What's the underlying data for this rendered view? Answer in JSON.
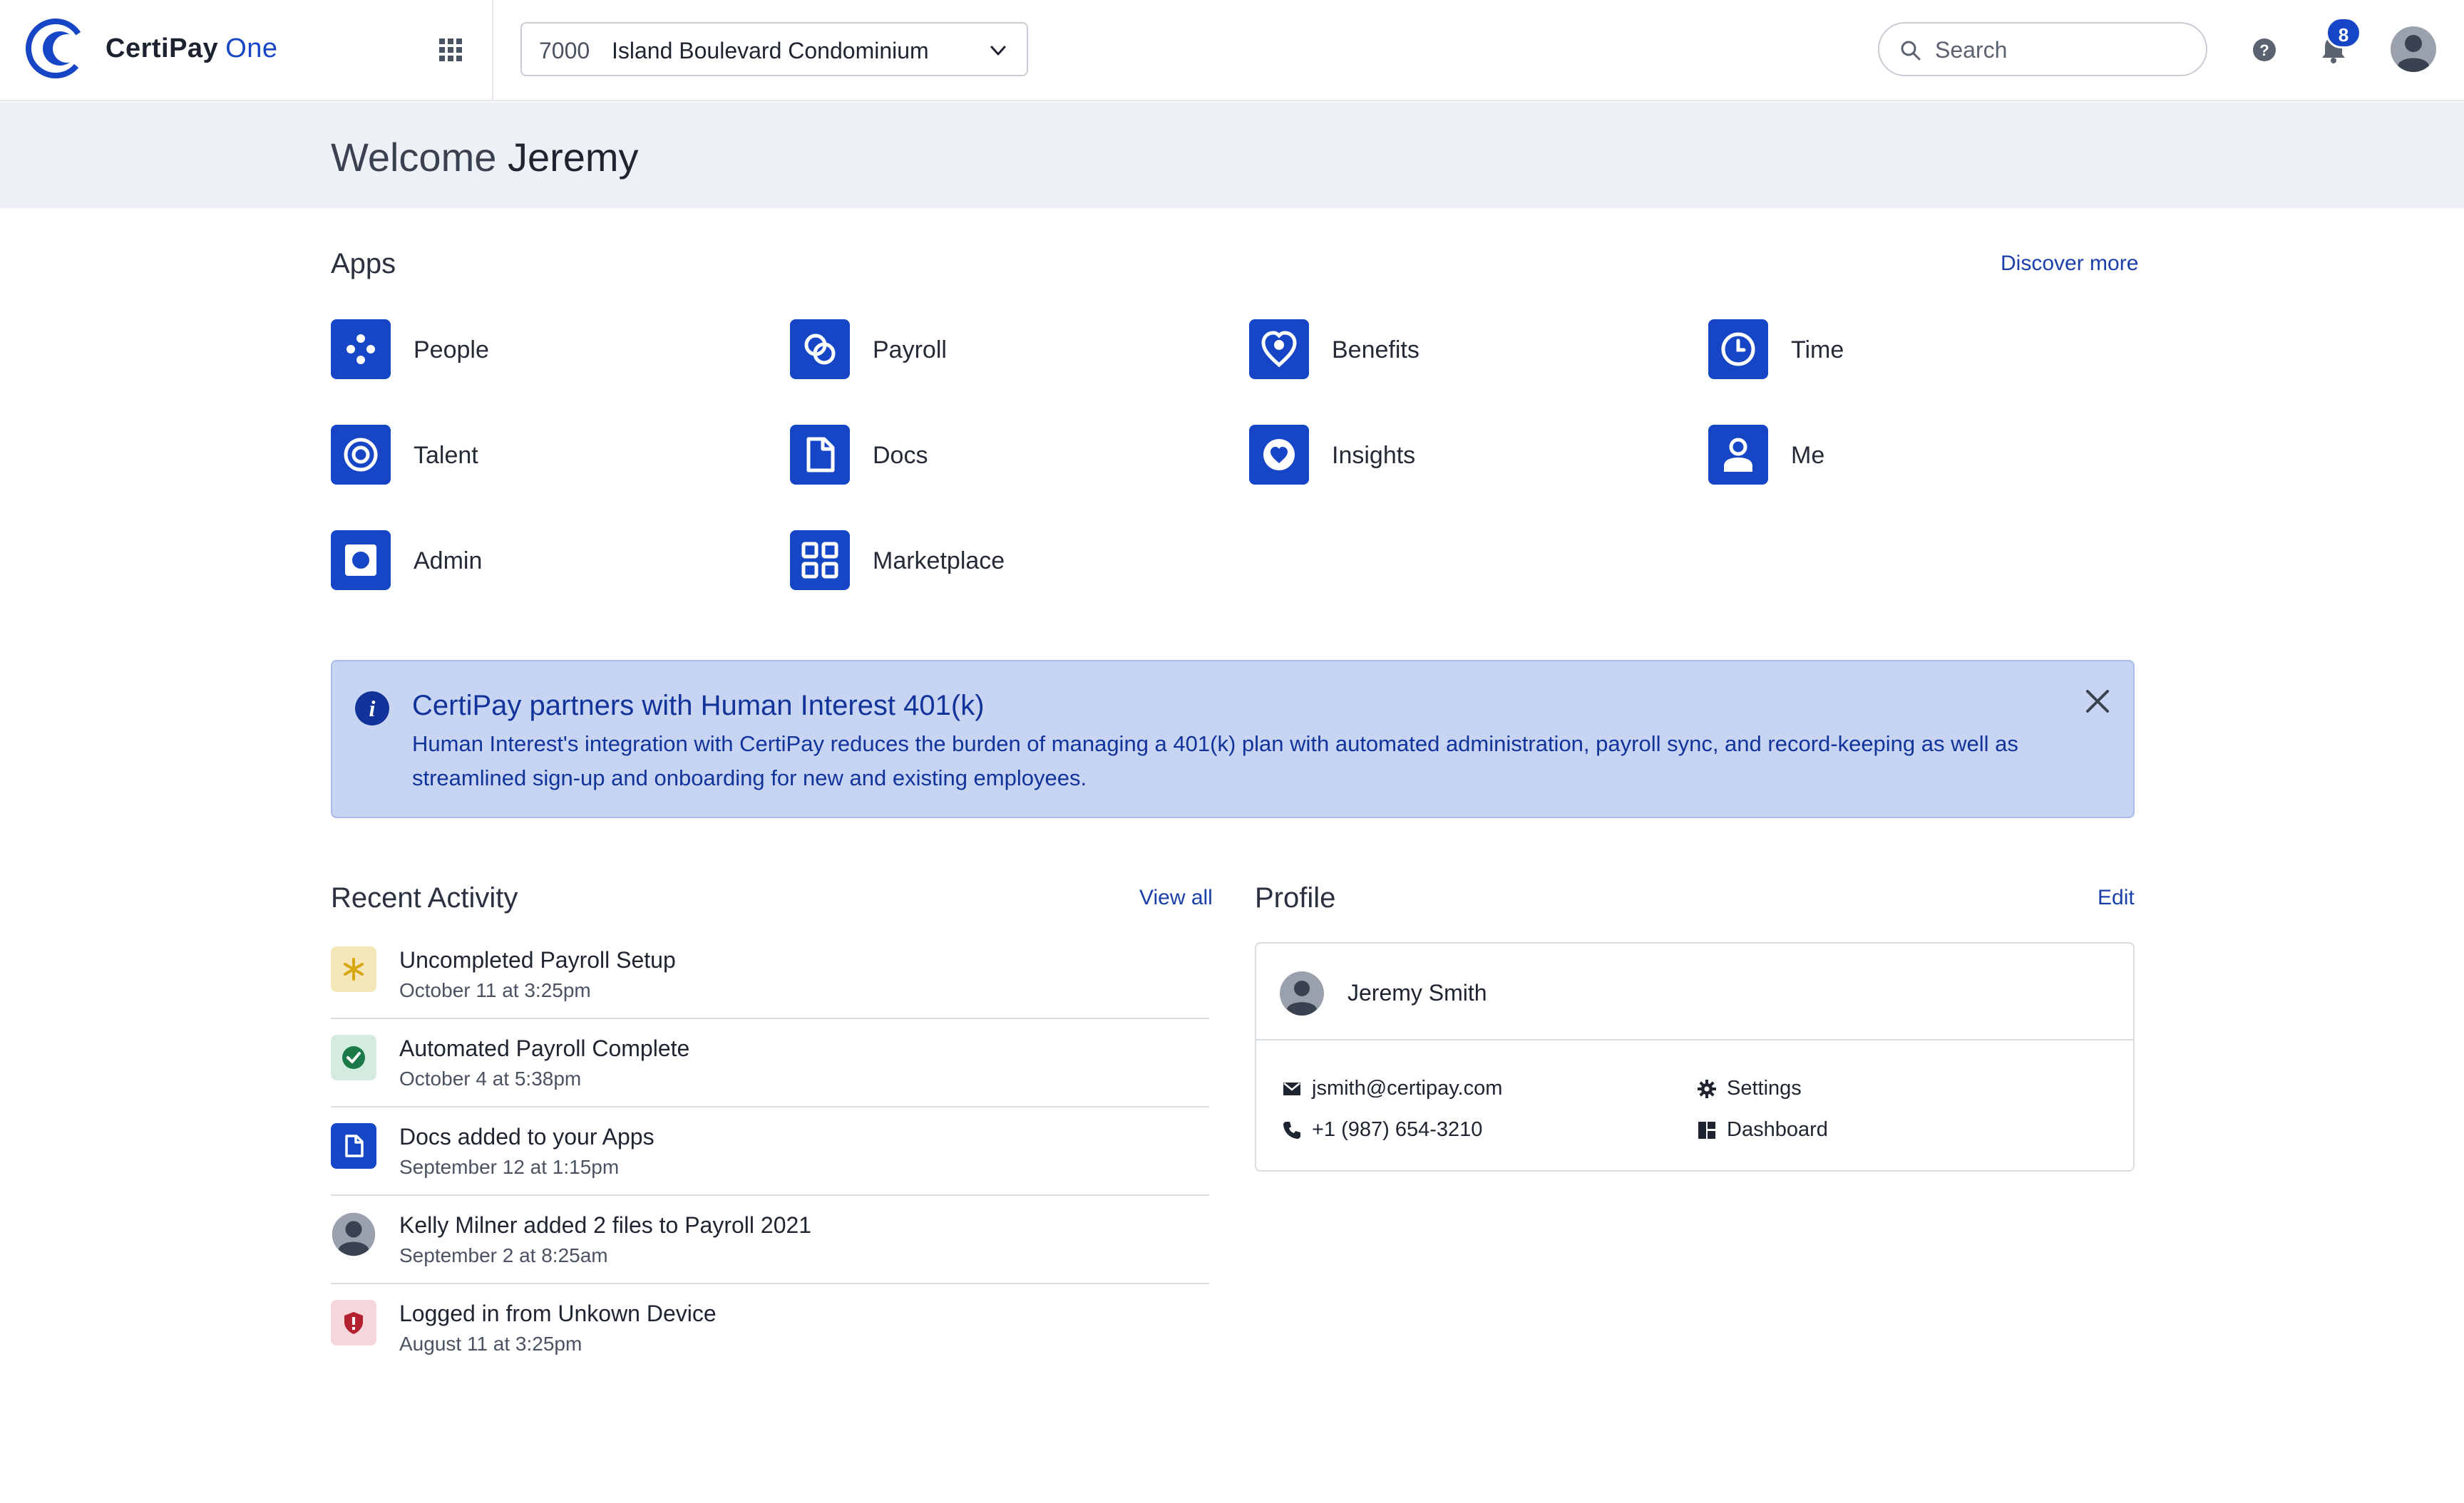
{
  "header": {
    "brand_name": "CertiPay",
    "brand_suffix": "One",
    "company_code": "7000",
    "company_name": "Island Boulevard Condominium",
    "search_placeholder": "Search",
    "notification_count": "8",
    "brand_color": "#1646c6"
  },
  "welcome": {
    "greeting": "Welcome",
    "name": "Jeremy"
  },
  "apps": {
    "title": "Apps",
    "discover_label": "Discover more",
    "items": [
      {
        "label": "People",
        "icon": "people-icon"
      },
      {
        "label": "Payroll",
        "icon": "payroll-icon"
      },
      {
        "label": "Benefits",
        "icon": "benefits-icon"
      },
      {
        "label": "Time",
        "icon": "clock-icon"
      },
      {
        "label": "Talent",
        "icon": "target-icon"
      },
      {
        "label": "Docs",
        "icon": "document-icon"
      },
      {
        "label": "Insights",
        "icon": "insights-icon"
      },
      {
        "label": "Me",
        "icon": "person-icon"
      },
      {
        "label": "Admin",
        "icon": "admin-icon"
      },
      {
        "label": "Marketplace",
        "icon": "grid-icon"
      }
    ]
  },
  "banner": {
    "title": "CertiPay partners with Human Interest 401(k)",
    "text": "Human Interest's integration with CertiPay reduces the burden of managing a 401(k) plan with automated administration, payroll sync, and record-keeping as well as streamlined sign-up and onboarding for new and existing employees."
  },
  "activity": {
    "title": "Recent Activity",
    "view_all_label": "View all",
    "items": [
      {
        "title": "Uncompleted Payroll Setup",
        "time": "October 11 at 3:25pm",
        "icon": "asterisk-icon",
        "color": "#f5e7b8"
      },
      {
        "title": "Automated Payroll Complete",
        "time": "October 4 at 5:38pm",
        "icon": "check-circle-icon",
        "color": "#d4ece0"
      },
      {
        "title": "Docs added to your Apps",
        "time": "September 12 at 1:15pm",
        "icon": "document-icon",
        "color": "#1646c6"
      },
      {
        "title": "Kelly Milner added 2 files to Payroll 2021",
        "time": "September 2 at 8:25am",
        "icon": "user-avatar-icon",
        "color": "#ffffff"
      },
      {
        "title": "Logged in from Unkown Device",
        "time": "August 11 at 3:25pm",
        "icon": "shield-alert-icon",
        "color": "#f6d6da"
      }
    ]
  },
  "profile": {
    "title": "Profile",
    "edit_label": "Edit",
    "name": "Jeremy Smith",
    "email": "jsmith@certipay.com",
    "phone": "+1 (987) 654-3210",
    "settings_label": "Settings",
    "dashboard_label": "Dashboard"
  }
}
